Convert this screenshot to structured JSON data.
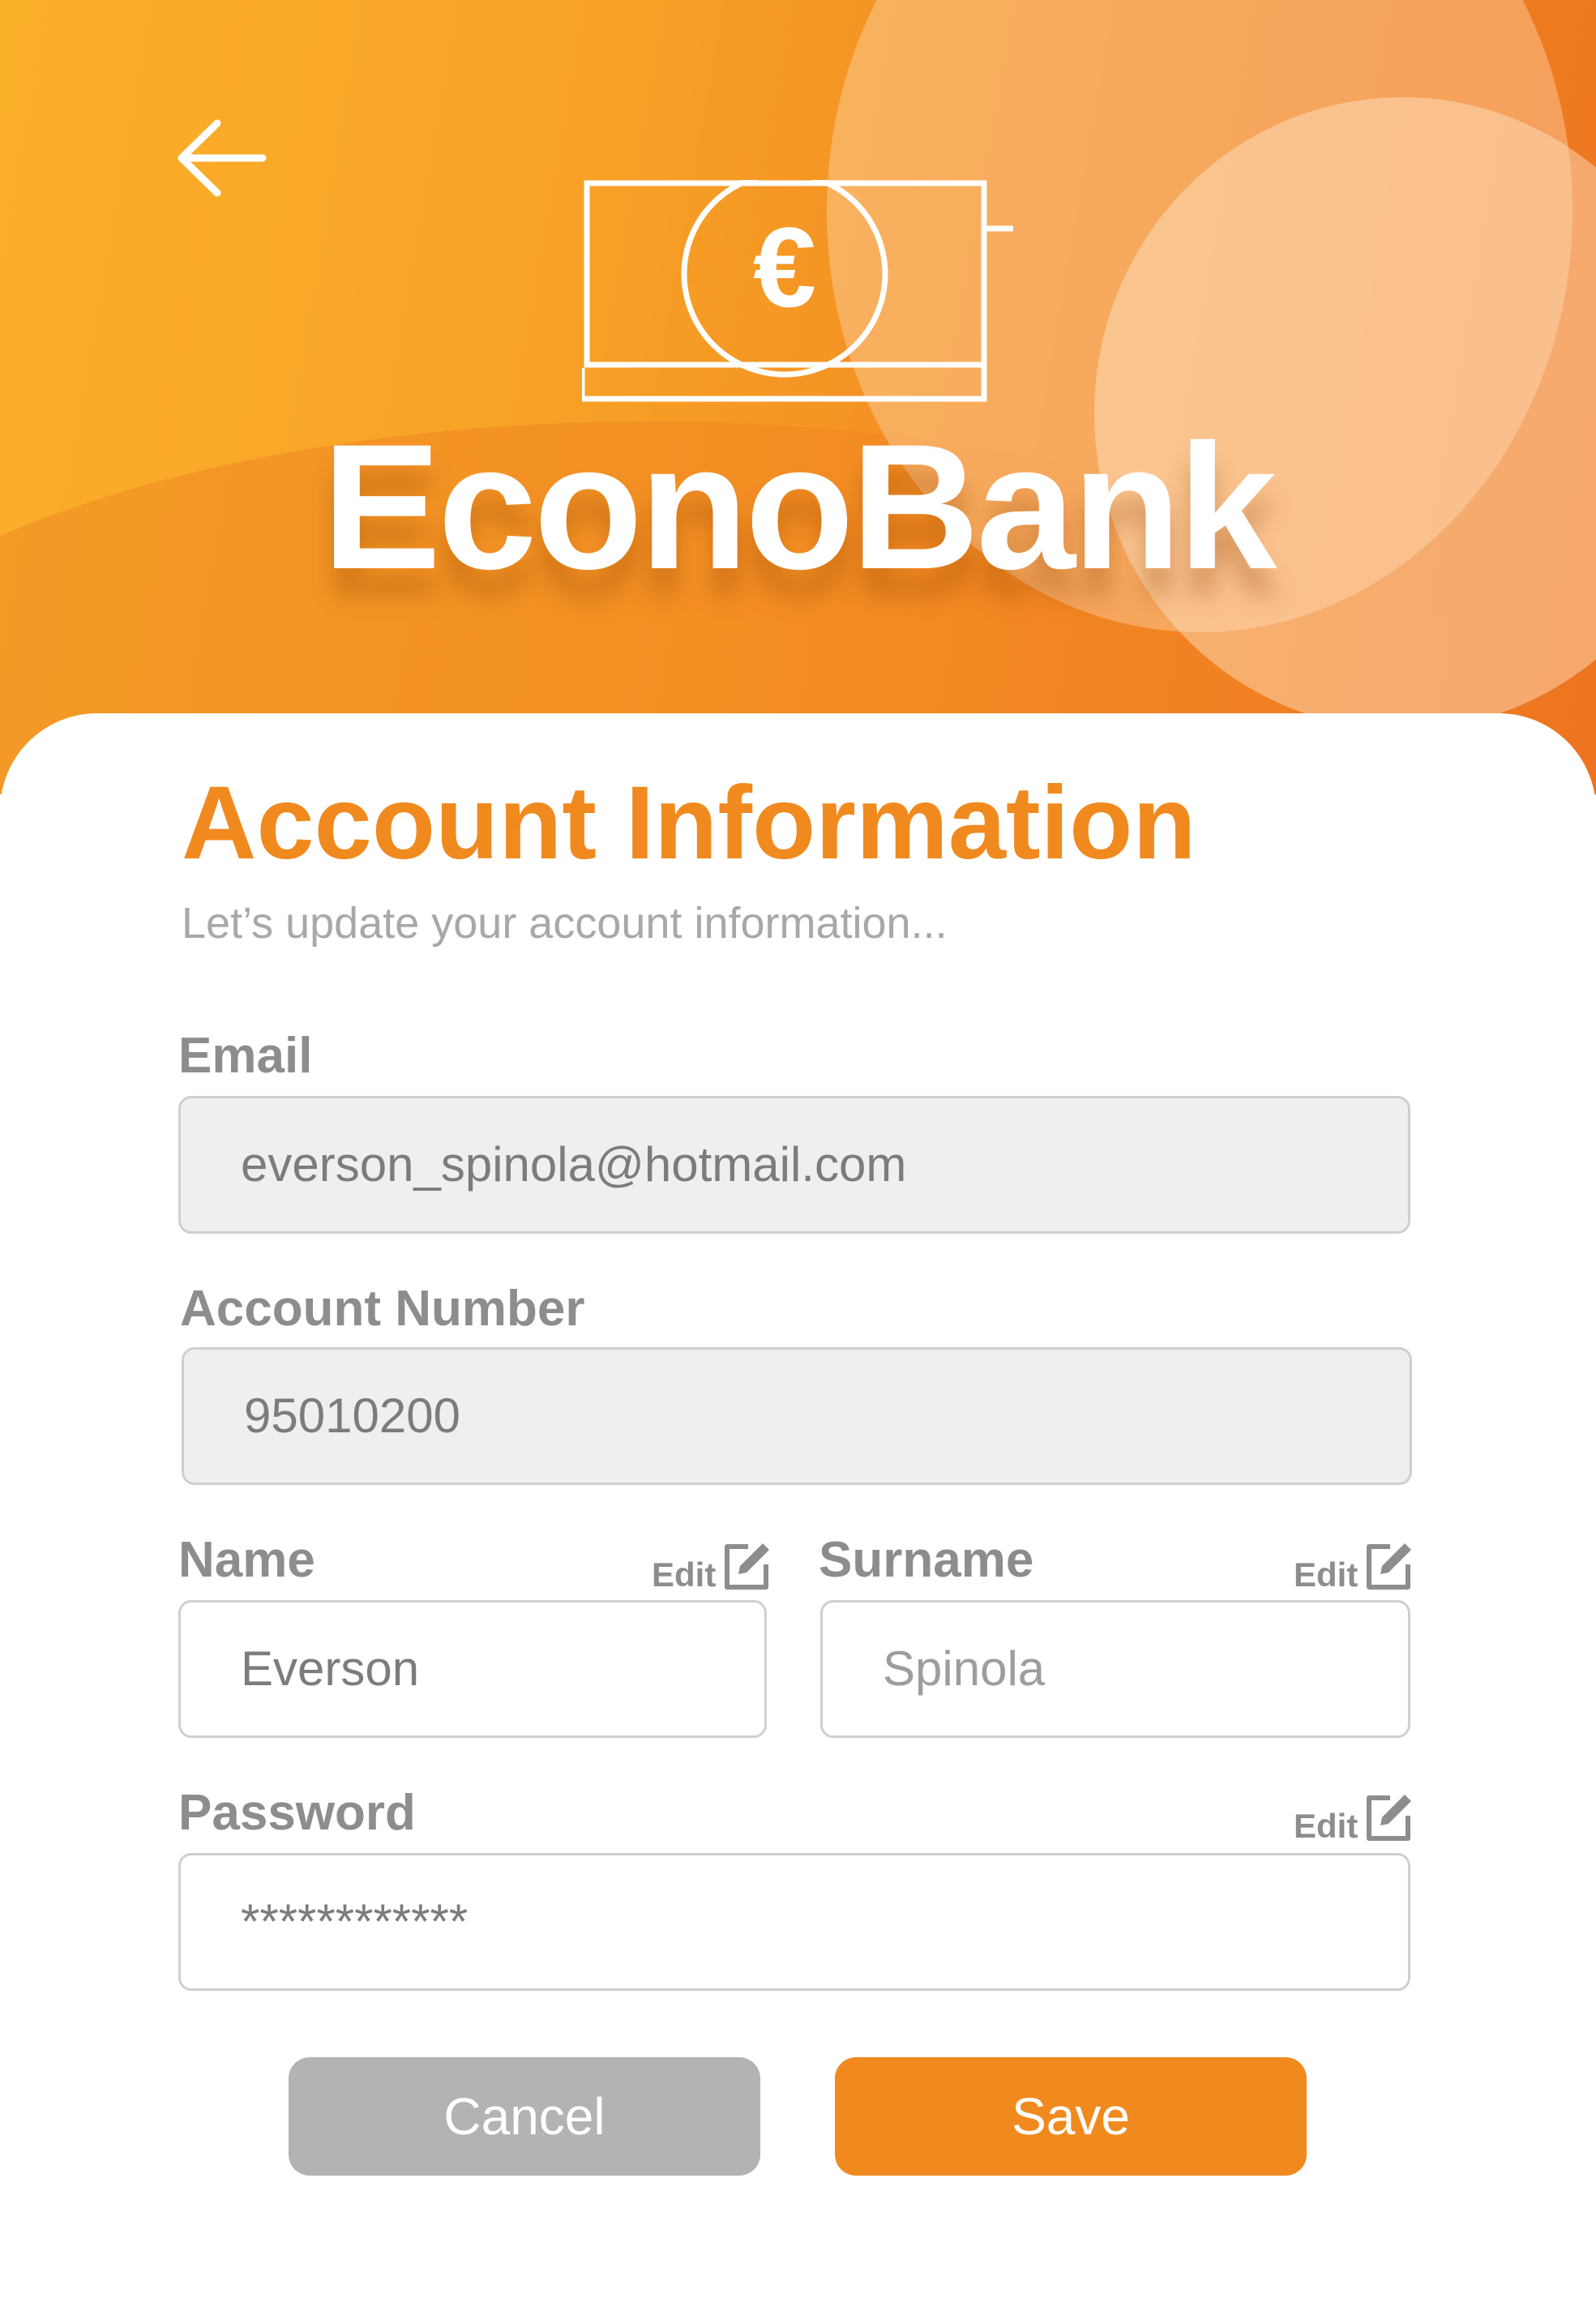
{
  "header": {
    "brand_name": "EconoBank",
    "back_icon": "arrow-left-icon",
    "logo_icon": "euro-banknote-icon",
    "logo_symbol": "€",
    "gradient_colors": [
      "#fbb02a",
      "#f28a22",
      "#ee7420"
    ]
  },
  "form": {
    "title": "Account Information",
    "subtitle": "Let’s update your account information...",
    "email": {
      "label": "Email",
      "value": "everson_spinola@hotmail.com"
    },
    "account_number": {
      "label": "Account Number",
      "value": "95010200"
    },
    "name": {
      "label": "Name",
      "value": "Everson",
      "edit_label": "Edit"
    },
    "surname": {
      "label": "Surname",
      "placeholder": "Spinola",
      "edit_label": "Edit"
    },
    "password": {
      "label": "Password",
      "value": "************",
      "edit_label": "Edit"
    },
    "edit_icon": "edit-pencil-icon"
  },
  "actions": {
    "cancel_label": "Cancel",
    "save_label": "Save",
    "accent_color": "#f08a1f",
    "cancel_color": "#b3b3b3"
  }
}
